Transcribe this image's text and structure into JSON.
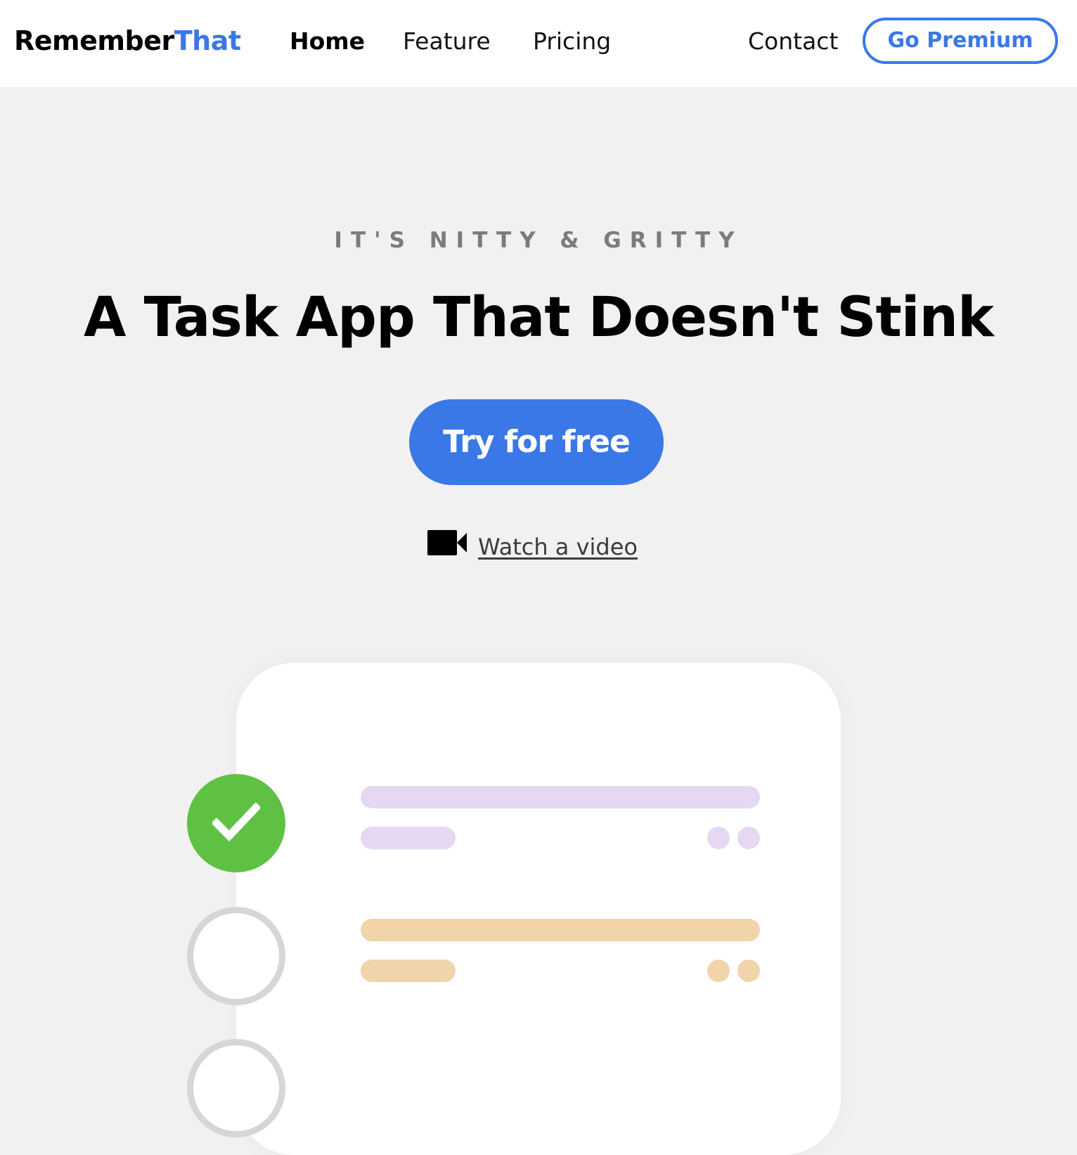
{
  "header": {
    "logo_part1": "Remember",
    "logo_part2": "That",
    "nav": {
      "home": "Home",
      "feature": "Feature",
      "pricing": "Pricing",
      "contact": "Contact"
    },
    "premium_label": "Go Premium"
  },
  "hero": {
    "eyebrow": "IT'S NITTY & GRITTY",
    "headline": "A Task App That Doesn't Stink",
    "cta_label": "Try for free",
    "video_link": " Watch a video",
    "video_icon": "video-camera-icon"
  },
  "illustration": {
    "tasks": [
      {
        "state": "done",
        "bar_color": "#e6d7f2",
        "icon": "checkmark-icon"
      },
      {
        "state": "todo",
        "bar_color": "#f2d4ab",
        "icon": "empty-circle-icon"
      }
    ]
  },
  "colors": {
    "accent": "#3a78e8",
    "done_green": "#5fc144",
    "background": "#f1f1f1"
  }
}
